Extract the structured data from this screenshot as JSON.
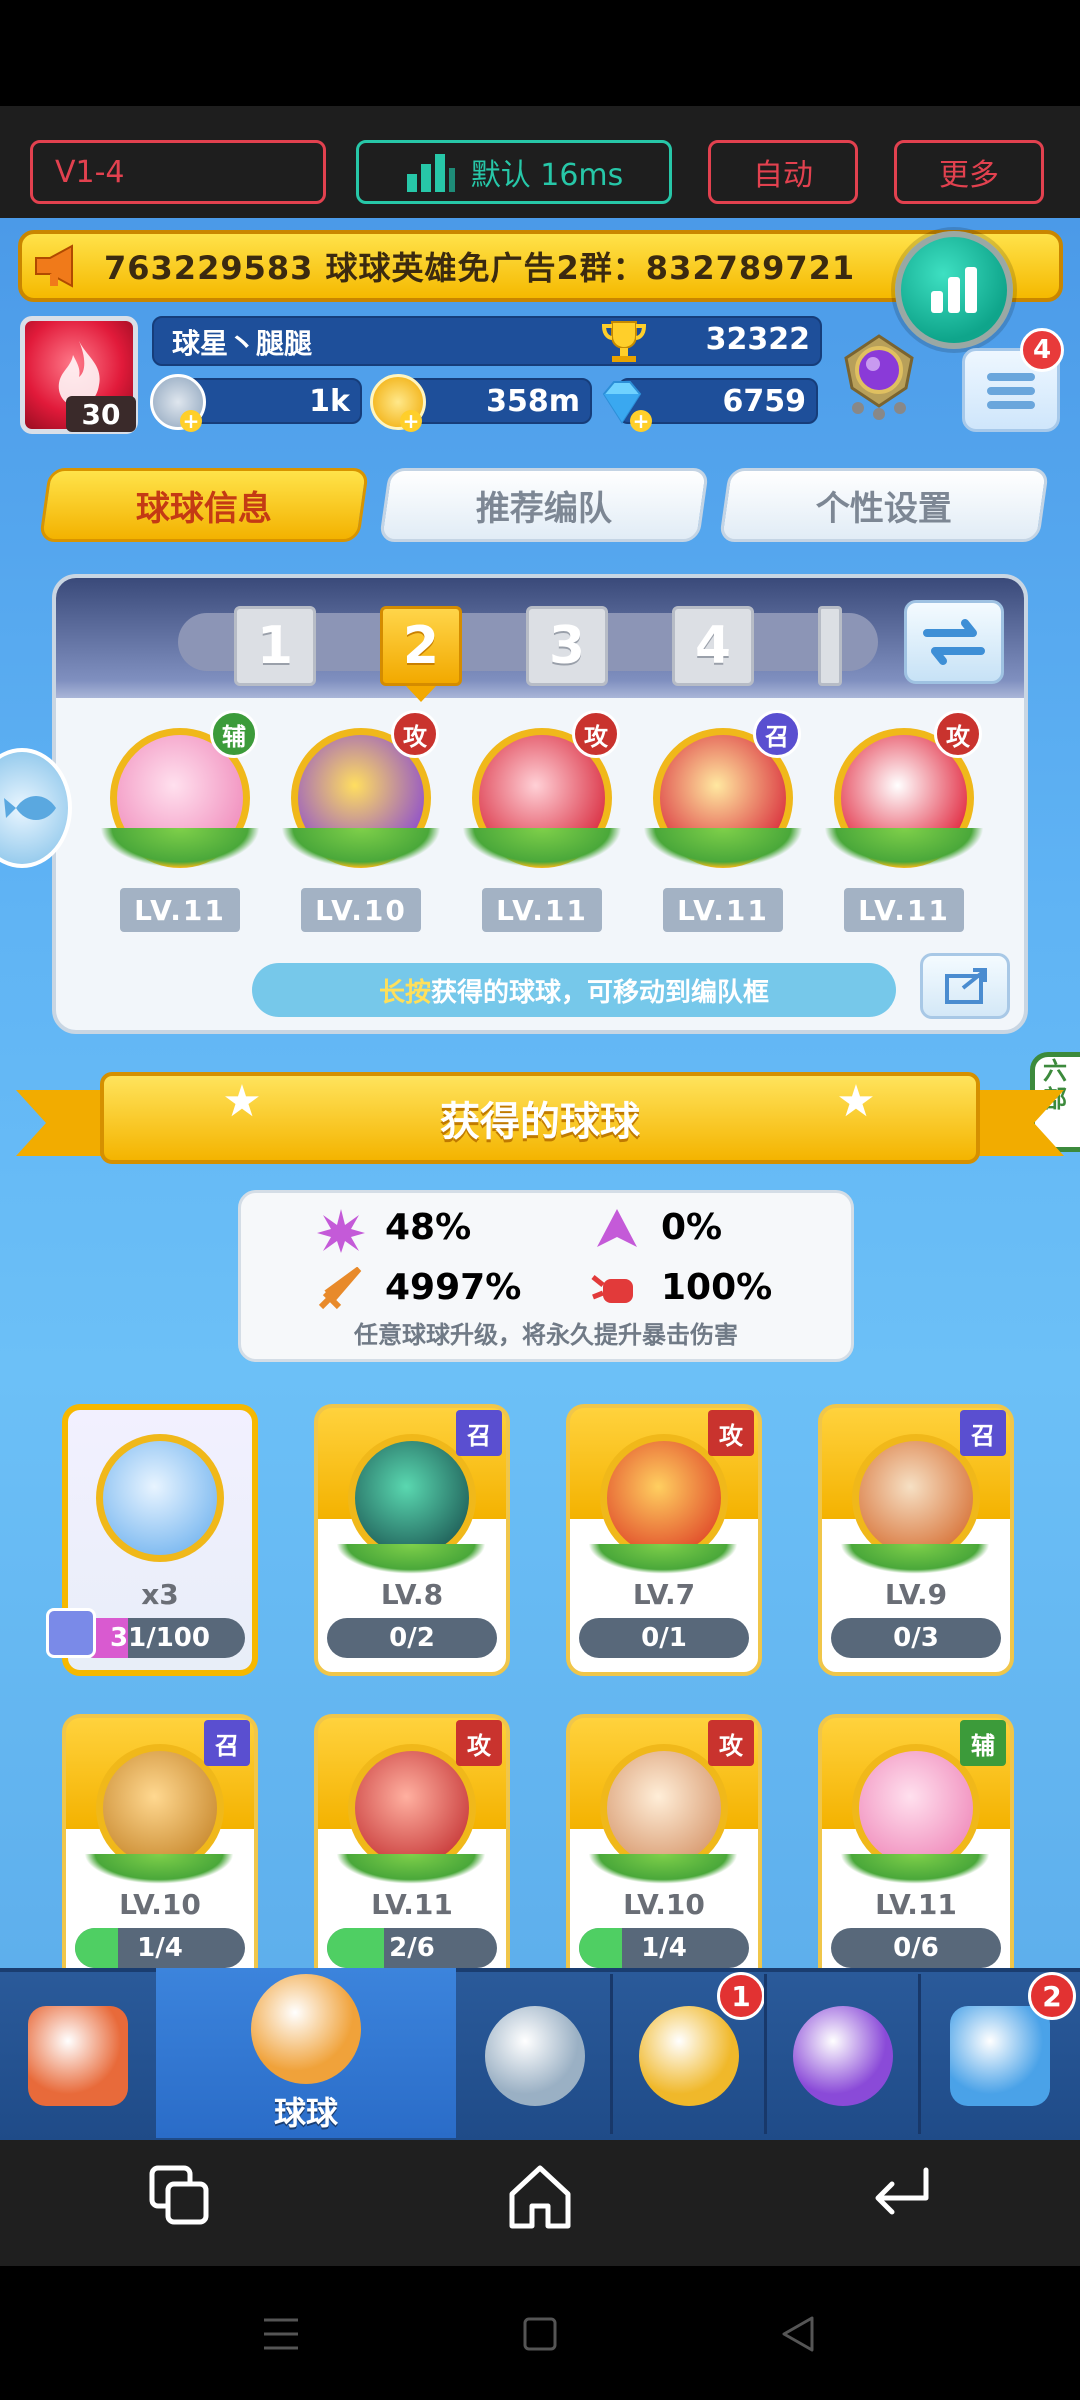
{
  "toolbar": {
    "version": "V1-4",
    "network_label": "默认 16ms",
    "auto_label": "自动",
    "more_label": "更多",
    "accent_color": "#e2414f",
    "network_color": "#27c7a8"
  },
  "announcement": "763229583 球球英雄免广告2群：832789721",
  "player": {
    "level": "30",
    "name": "球星丶腿腿",
    "trophies": "32322",
    "resource1": "1k",
    "resource2": "358m",
    "gems": "6759",
    "menu_badge": "4"
  },
  "tabs": [
    {
      "label": "球球信息",
      "active": true
    },
    {
      "label": "推荐编队",
      "active": false
    },
    {
      "label": "个性设置",
      "active": false
    }
  ],
  "team": {
    "slots": [
      "1",
      "2",
      "3",
      "4"
    ],
    "active_slot": "2",
    "balls": [
      {
        "role": "辅",
        "role_type": "support",
        "level": "LV.11",
        "icon": "pink-shield-ball"
      },
      {
        "role": "攻",
        "role_type": "attack",
        "level": "LV.10",
        "icon": "dinosaur-ball"
      },
      {
        "role": "攻",
        "role_type": "attack",
        "level": "LV.11",
        "icon": "red-hero-ball"
      },
      {
        "role": "召",
        "role_type": "summon",
        "level": "LV.11",
        "icon": "red-mecha-ball"
      },
      {
        "role": "攻",
        "role_type": "attack",
        "level": "LV.11",
        "icon": "ultraman-ball"
      }
    ],
    "hint_highlight": "长按",
    "hint_text": "获得的球球，可移动到编队框"
  },
  "side_tab_right": "六\n部",
  "section_title": "获得的球球",
  "stats": [
    {
      "icon": "crit-rate-icon",
      "value": "48%",
      "color": "#c45ad8"
    },
    {
      "icon": "dodge-icon",
      "value": "0%",
      "color": "#c45ad8"
    },
    {
      "icon": "sword-icon",
      "value": "4997%",
      "color": "#e88a2a"
    },
    {
      "icon": "fist-icon",
      "value": "100%",
      "color": "#e23a3a"
    }
  ],
  "stats_note": "任意球球升级，将永久提升暴击伤害",
  "cards": [
    {
      "special": true,
      "count": "x3",
      "progress": "31/100",
      "fill": 0.31,
      "icon": "rainbow-gem-ball"
    },
    {
      "role": "召",
      "role_type": "summon",
      "level": "LV.8",
      "progress": "0/2",
      "fill": 0,
      "icon": "green-vortex-ball"
    },
    {
      "role": "攻",
      "role_type": "attack",
      "level": "LV.7",
      "progress": "0/1",
      "fill": 0,
      "icon": "fire-flower-ball"
    },
    {
      "role": "召",
      "role_type": "summon",
      "level": "LV.9",
      "progress": "0/3",
      "fill": 0,
      "icon": "monkey-ball"
    },
    {
      "role": "召",
      "role_type": "summon",
      "level": "LV.10",
      "progress": "1/4",
      "fill": 0.25,
      "icon": "bear-ball"
    },
    {
      "role": "攻",
      "role_type": "attack",
      "level": "LV.11",
      "progress": "2/6",
      "fill": 0.333,
      "icon": "red-bear-ball"
    },
    {
      "role": "攻",
      "role_type": "attack",
      "level": "LV.10",
      "progress": "1/4",
      "fill": 0.25,
      "icon": "old-man-ball"
    },
    {
      "role": "辅",
      "role_type": "support",
      "level": "LV.11",
      "progress": "0/6",
      "fill": 0,
      "icon": "pink-shield-ball"
    }
  ],
  "bottom_nav": [
    {
      "icon": "shop-icon",
      "label": "",
      "badge": ""
    },
    {
      "icon": "ball-icon",
      "label": "球球",
      "badge": "",
      "active": true
    },
    {
      "icon": "crossed-swords-icon",
      "label": "",
      "badge": ""
    },
    {
      "icon": "whistle-icon",
      "label": "",
      "badge": "1"
    },
    {
      "icon": "planet-icon",
      "label": "",
      "badge": ""
    },
    {
      "icon": "chat-heart-icon",
      "label": "",
      "badge": "2"
    }
  ]
}
